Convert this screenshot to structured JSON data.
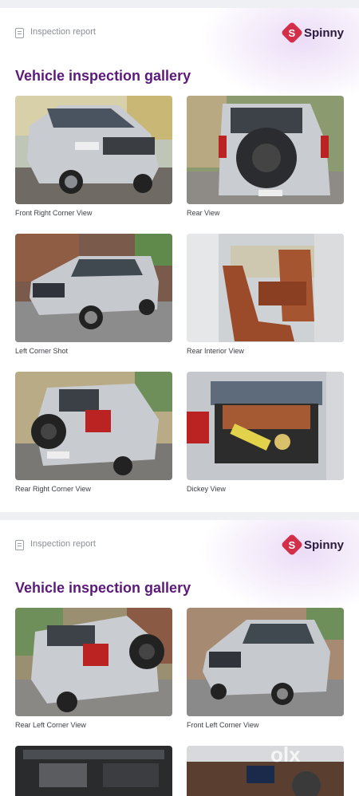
{
  "cards": [
    {
      "report_label": "Inspection report",
      "logo_text": "Spinny",
      "logo_mark": "S",
      "title": "Vehicle inspection gallery",
      "photos": [
        {
          "caption": "Front Right Corner View"
        },
        {
          "caption": "Rear View"
        },
        {
          "caption": "Left Corner Shot"
        },
        {
          "caption": "Rear Interior View"
        },
        {
          "caption": "Rear Right Corner View"
        },
        {
          "caption": "Dickey View"
        }
      ]
    },
    {
      "report_label": "Inspection report",
      "logo_text": "Spinny",
      "logo_mark": "S",
      "title": "Vehicle inspection gallery",
      "photos": [
        {
          "caption": "Rear Left Corner View"
        },
        {
          "caption": "Front Left Corner View"
        }
      ]
    }
  ],
  "watermark": "olx",
  "colors": {
    "title": "#5b1a7a",
    "brand": "#d32f4a",
    "car_body": "#c9cdd1"
  }
}
